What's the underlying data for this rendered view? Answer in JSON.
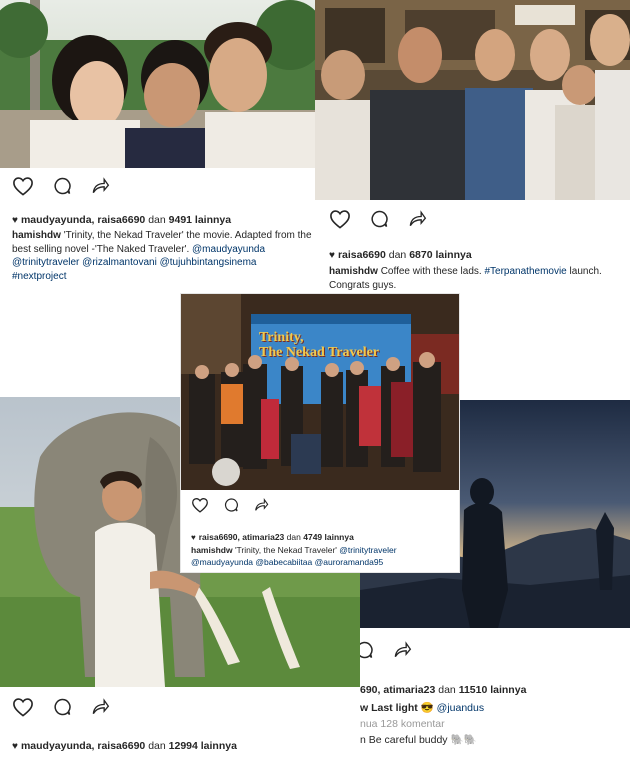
{
  "post1": {
    "likes_prefix": "maudyayunda, raisa6690",
    "likes_mid": "dan",
    "likes_count": "9491 lainnya",
    "username": "hamishdw",
    "caption_text": "'Trinity, the Nekad Traveler' the movie. Adapted from the best selling novel -'The Naked Traveler'.",
    "mentions": [
      "@maudyayunda",
      "@trinitytraveler",
      "@rizalmantovani",
      "@tujuhbintangsinema"
    ],
    "hashtag": "#nextproject"
  },
  "post2": {
    "likes_prefix": "raisa6690",
    "likes_mid": "dan",
    "likes_count": "6870 lainnya",
    "username": "hamishdw",
    "caption_text": "Coffee with these lads.",
    "hashtag": "#Terpanathemovie",
    "caption_tail": "launch.",
    "caption_line2": "Congrats guys."
  },
  "post3": {
    "banner_line1": "Trinity,",
    "banner_line2": "The Nekad Traveler",
    "likes_prefix": "raisa6690, atimaria23",
    "likes_mid": "dan",
    "likes_count": "4749 lainnya",
    "username": "hamishdw",
    "caption_text": "'Trinity, the Nekad Traveler'",
    "mentions_line1": "@trinitytraveler",
    "mentions_line2": [
      "@maudyayunda",
      "@babecabiitaa",
      "@auroramanda95"
    ]
  },
  "post4": {
    "likes_prefix": "maudyayunda, raisa6690",
    "likes_mid": "dan",
    "likes_count": "12994 lainnya"
  },
  "post5": {
    "likes_prefix": "690, atimaria23",
    "likes_mid": "dan",
    "likes_count": "11510 lainnya",
    "caption_prefix": "w Last light",
    "caption_mention": "@juandus",
    "comments_text": "nua 128 komentar",
    "comment_text": "n Be careful buddy",
    "comment_emoji": "🐘🐘"
  },
  "colors": {
    "text": "#262626",
    "mention": "#003569",
    "muted": "#999999",
    "sky_dusk": "#2b3b55",
    "banner_blue": "#3b86c8"
  },
  "icons": [
    "heart-outline-icon",
    "comment-icon",
    "share-icon",
    "heart-filled-icon",
    "mention-emoji-icon"
  ]
}
